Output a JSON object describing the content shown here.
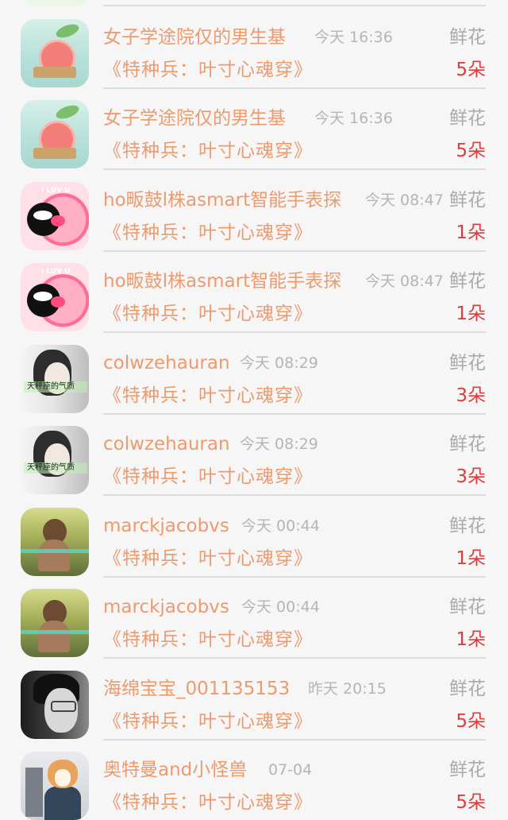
{
  "rows": [
    {
      "name": "女子学途院仅的男生基",
      "time": "今天 16:36",
      "gift": "鲜花",
      "book": "《特种兵：叶寸心魂穿》",
      "count": "5朵",
      "avatar": "tea-cup-avatar"
    },
    {
      "name": "女子学途院仅的男生基",
      "time": "今天 16:36",
      "gift": "鲜花",
      "book": "《特种兵：叶寸心魂穿》",
      "count": "5朵",
      "avatar": "tea-cup-avatar"
    },
    {
      "name": "ho畈鼓l株asmart智能手表探",
      "time": "今天 08:47",
      "gift": "鲜花",
      "book": "《特种兵：叶寸心魂穿》",
      "count": "1朵",
      "avatar": "heart-kiss-avatar",
      "avatar_text": "I LUV U"
    },
    {
      "name": "ho畈鼓l株asmart智能手表探",
      "time": "今天 08:47",
      "gift": "鲜花",
      "book": "《特种兵：叶寸心魂穿》",
      "count": "1朵",
      "avatar": "heart-kiss-avatar",
      "avatar_text": "I LUV U"
    },
    {
      "name": "colwzehauran",
      "time": "今天 08:29",
      "gift": "鲜花",
      "book": "《特种兵：叶寸心魂穿》",
      "count": "3朵",
      "avatar": "girl-portrait-avatar",
      "avatar_text": "天秤座的气质"
    },
    {
      "name": "colwzehauran",
      "time": "今天 08:29",
      "gift": "鲜花",
      "book": "《特种兵：叶寸心魂穿》",
      "count": "3朵",
      "avatar": "girl-portrait-avatar",
      "avatar_text": "天秤座的气质"
    },
    {
      "name": "marckjacobvs",
      "time": "今天 00:44",
      "gift": "鲜花",
      "book": "《特种兵：叶寸心魂穿》",
      "count": "1朵",
      "avatar": "field-girl-avatar"
    },
    {
      "name": "marckjacobvs",
      "time": "今天 00:44",
      "gift": "鲜花",
      "book": "《特种兵：叶寸心魂穿》",
      "count": "1朵",
      "avatar": "field-girl-avatar"
    },
    {
      "name": "海绵宝宝_001135153",
      "time": "昨天 20:15",
      "gift": "鲜花",
      "book": "《特种兵：叶寸心魂穿》",
      "count": "5朵",
      "avatar": "man-glasses-avatar"
    },
    {
      "name": "奥特曼and小怪兽",
      "time": "07-04",
      "gift": "鲜花",
      "book": "《特种兵：叶寸心魂穿》",
      "count": "5朵",
      "avatar": "shiba-dog-avatar"
    }
  ],
  "colors": {
    "name": "#ed9a6d",
    "time": "#b5b5b5",
    "gift": "#aaaaaa",
    "count": "#dc3d3d",
    "divider": "#dcdcdc",
    "background": "#f6f6f7"
  }
}
